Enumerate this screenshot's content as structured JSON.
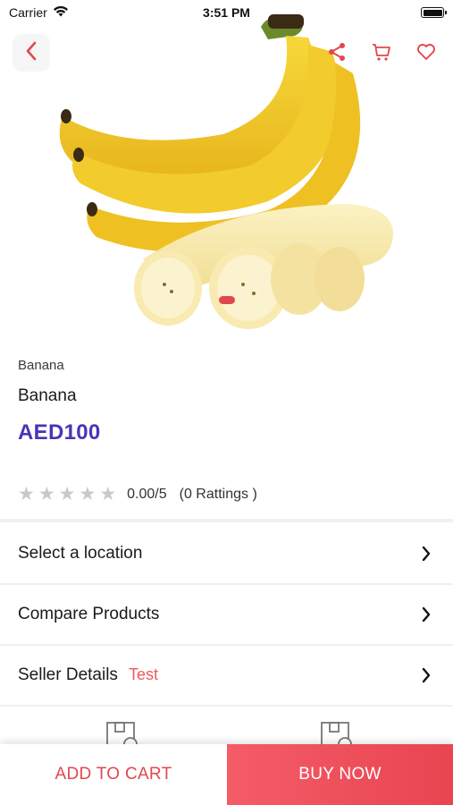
{
  "status_bar": {
    "carrier": "Carrier",
    "time": "3:51 PM",
    "battery_level": 1.0
  },
  "header": {
    "back_icon": "chevron-left-icon",
    "actions": [
      "share-icon",
      "cart-icon",
      "heart-icon"
    ]
  },
  "product": {
    "image_icon": "banana-image",
    "brand": "Banana",
    "name": "Banana",
    "price": "AED100",
    "rating": {
      "stars_filled": 0,
      "stars_total": 5,
      "value_text": "0.00/5",
      "count_text": "(0  Rattings )"
    }
  },
  "rows": [
    {
      "label": "Select a location",
      "sub": ""
    },
    {
      "label": "Compare Products",
      "sub": ""
    },
    {
      "label": "Seller Details",
      "sub": "Test"
    }
  ],
  "actions": {
    "add_to_cart": "ADD TO CART",
    "buy_now": "BUY NOW"
  },
  "colors": {
    "accent_red": "#e2474f",
    "price_blue": "#4536b8",
    "star_gray": "#c9c9c9"
  }
}
